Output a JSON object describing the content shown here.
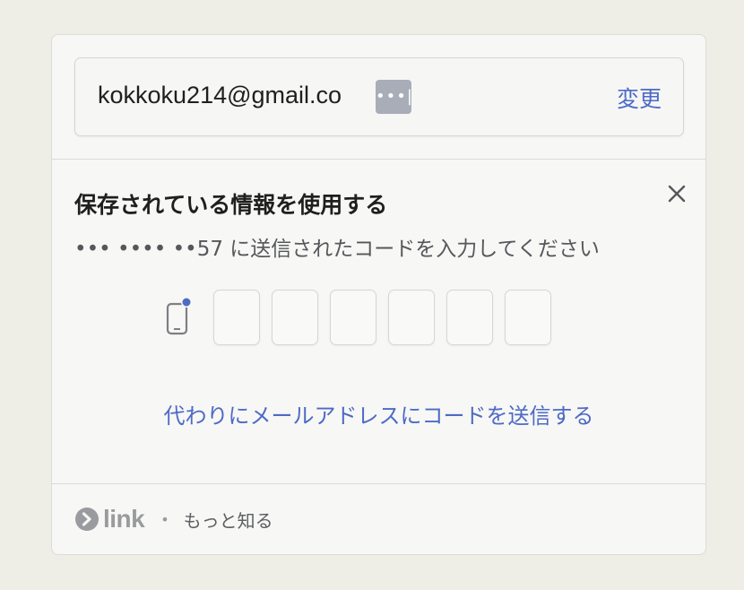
{
  "email_field": {
    "value": "kokkoku214@gmail.co",
    "password_manager_icon": "ellipsis-key-icon",
    "change_label": "変更"
  },
  "verification": {
    "title": "保存されている情報を使用する",
    "subtitle": "••• •••• ••57 に送信されたコードを入力してください",
    "code_digits": [
      "",
      "",
      "",
      "",
      "",
      ""
    ],
    "resend_label": "代わりにメールアドレスにコードを送信する"
  },
  "footer": {
    "brand": "link",
    "separator": "•",
    "learn_more_label": "もっと知る"
  },
  "colors": {
    "accent": "#4d6ac6",
    "phone_dot": "#4d6ac6",
    "muted_text": "#55575b"
  }
}
